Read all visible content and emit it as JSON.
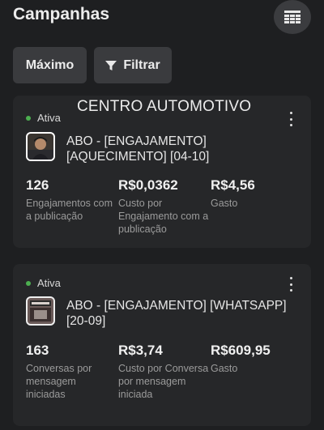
{
  "header": {
    "title": "Campanhas",
    "table_icon": "table-icon"
  },
  "toolbar": {
    "max_label": "Máximo",
    "filter_label": "Filtrar",
    "filter_icon": "filter-icon"
  },
  "overlay": {
    "text": "CENTRO AUTOMOTIVO"
  },
  "campaigns": [
    {
      "status": "Ativa",
      "status_color": "#4caf50",
      "name": "ABO - [ENGAJAMENTO] [AQUECIMENTO] [04-10]",
      "metrics": [
        {
          "value": "126",
          "label": "Engajamentos com a publicação"
        },
        {
          "value": "R$0,0362",
          "label": "Custo por Engajamento com a publicação"
        },
        {
          "value": "R$4,56",
          "label": "Gasto"
        }
      ]
    },
    {
      "status": "Ativa",
      "status_color": "#4caf50",
      "name": "ABO - [ENGAJAMENTO] [WHATSAPP] [20-09]",
      "metrics": [
        {
          "value": "163",
          "label": "Conversas por mensagem iniciadas"
        },
        {
          "value": "R$3,74",
          "label": "Custo por Conversa por mensagem iniciada"
        },
        {
          "value": "R$609,95",
          "label": "Gasto"
        }
      ]
    }
  ]
}
